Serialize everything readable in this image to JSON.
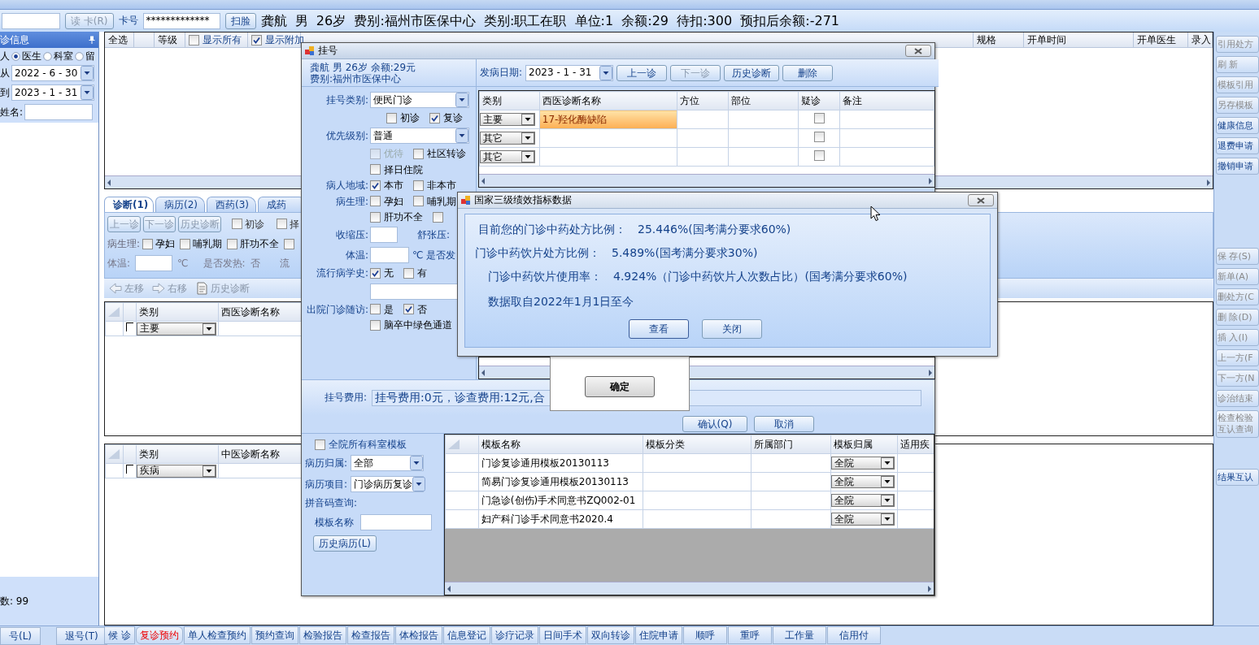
{
  "toolbar": {
    "read_card_button": "读 卡(R)",
    "card_label": "卡号",
    "card_number": "*************",
    "face_button": "扫脸",
    "patient_summary": "龚航  男  26岁  费别:福州市医保中心  类别:职工在职  单位:1  余额:29  待扣:300  预扣后余额:-271"
  },
  "left_panel": {
    "title": "诊信息",
    "radios": [
      {
        "label": "人",
        "selected": false
      },
      {
        "label": "医生",
        "selected": true
      },
      {
        "label": "科室",
        "selected": false
      },
      {
        "label": "留",
        "selected": false
      }
    ],
    "from_label": "从",
    "from_date": "2022 - 6 - 30",
    "to_label": "到",
    "to_date": "2023 - 1 - 31",
    "name_label": "姓名:",
    "count": "数: 99"
  },
  "main_grid": {
    "left_columns": [
      "全选",
      "等级"
    ],
    "toggles": [
      {
        "label": "显示所有",
        "checked": false
      },
      {
        "label": "显示附加",
        "checked": true
      }
    ],
    "right_columns": [
      "规格",
      "开单时间",
      "开单医生",
      "录入"
    ]
  },
  "tabs": [
    {
      "label": "诊断(1)",
      "selected": true
    },
    {
      "label": "病历(2)",
      "selected": false
    },
    {
      "label": "西药(3)",
      "selected": false
    },
    {
      "label": "成药",
      "selected": false
    }
  ],
  "diagnosis_panel": {
    "buttons": [
      "上一诊",
      "下一诊",
      "历史诊断"
    ],
    "visit_options": [
      {
        "label": "初诊",
        "checked": false
      },
      {
        "label": "择",
        "checked": false
      }
    ],
    "physiology_label": "病生理:",
    "physiology": [
      {
        "label": "孕妇",
        "checked": false
      },
      {
        "label": "哺乳期",
        "checked": false
      },
      {
        "label": "肝功不全",
        "checked": false
      },
      {
        "checked": false
      }
    ],
    "temperature_label": "体温:",
    "temperature_unit": "℃",
    "fever_label": "是否发热:",
    "fever_value": "否",
    "cut_label": "流"
  },
  "move_toolbar": [
    {
      "kind": "left",
      "label": "左移"
    },
    {
      "kind": "right",
      "label": "右移"
    },
    {
      "kind": "history",
      "label": "历史诊断"
    }
  ],
  "western_grid": {
    "columns": [
      "类别",
      "西医诊断名称"
    ],
    "rows": [
      {
        "type": "主要",
        "checked": false
      }
    ]
  },
  "tcm_grid": {
    "columns": [
      "类别",
      "中医诊断名称"
    ],
    "rows": [
      {
        "type": "疾病",
        "checked": false
      }
    ]
  },
  "side_buttons": [
    {
      "label": "引用处方",
      "disabled": true
    },
    {
      "label": "刷 新",
      "disabled": true
    },
    {
      "label": "模板引用",
      "disabled": true
    },
    {
      "label": "另存模板",
      "disabled": true
    },
    {
      "label": "健康信息",
      "disabled": false
    },
    {
      "label": "退费申请",
      "disabled": false
    },
    {
      "label": "撤销申请",
      "disabled": false
    },
    {
      "label": "保 存(S)",
      "disabled": true
    },
    {
      "label": "新单(A)",
      "disabled": true
    },
    {
      "label": "删处方(C",
      "disabled": true
    },
    {
      "label": "删 除(D)",
      "disabled": true
    },
    {
      "label": "插 入(I)",
      "disabled": true
    },
    {
      "label": "上一方(F",
      "disabled": true
    },
    {
      "label": "下一方(N",
      "disabled": true
    },
    {
      "label": "诊治结束",
      "disabled": true
    },
    {
      "label": "检查检验互认查询",
      "disabled": true
    },
    {
      "label": "结果互认",
      "disabled": false
    }
  ],
  "left_buttons": [
    "号(L)",
    "退号(T)"
  ],
  "bottom_tabs": [
    {
      "label": "候 诊",
      "alert": false
    },
    {
      "label": "复诊预约",
      "alert": true
    },
    {
      "label": "单人检查预约",
      "alert": false
    },
    {
      "label": "预约查询",
      "alert": false
    },
    {
      "label": "检验报告",
      "alert": false
    },
    {
      "label": "检查报告",
      "alert": false
    },
    {
      "label": "体检报告",
      "alert": false
    },
    {
      "label": "信息登记",
      "alert": false
    },
    {
      "label": "诊疗记录",
      "alert": false
    },
    {
      "label": "日间手术",
      "alert": false
    },
    {
      "label": "双向转诊",
      "alert": false
    },
    {
      "label": "住院申请",
      "alert": false
    },
    {
      "label": "顺呼",
      "alert": false
    },
    {
      "label": "重呼",
      "alert": false
    },
    {
      "label": "工作量",
      "alert": false
    },
    {
      "label": "信用付",
      "alert": false
    }
  ],
  "register_dialog": {
    "title": "挂号",
    "patient_line": "龚航 男 26岁 余额:29元",
    "fee_type_line": "费别:福州市医保中心",
    "register_type_label": "挂号类别:",
    "register_type": "便民门诊",
    "visit": [
      {
        "label": "初诊",
        "checked": false
      },
      {
        "label": "复诊",
        "checked": true
      }
    ],
    "priority_label": "优先级别:",
    "priority": "普通",
    "priority_options": [
      {
        "label": "优待",
        "checked": false,
        "disabled": true
      },
      {
        "label": "社区转诊",
        "checked": false,
        "disabled": false
      }
    ],
    "hospitalize": {
      "label": "择日住院",
      "checked": false
    },
    "region_label": "病人地域:",
    "region": [
      {
        "label": "本市",
        "checked": true
      },
      {
        "label": "非本市",
        "checked": false
      }
    ],
    "physiology_label": "病生理:",
    "physiology": [
      {
        "label": "孕妇",
        "checked": false
      },
      {
        "label": "哺乳期",
        "checked": false
      },
      {
        "label": "肝功不全",
        "checked": false
      },
      {
        "checked": false
      }
    ],
    "systolic_label": "收缩压:",
    "diastolic_label": "舒张压:",
    "temperature_label": "体温:",
    "temperature_unit": "℃",
    "fever_label": "是否发",
    "epidemic_label": "流行病学史:",
    "epidemic": [
      {
        "label": "无",
        "checked": true
      },
      {
        "label": "有",
        "checked": false
      }
    ],
    "followup_label": "出院门诊随访:",
    "followup": [
      {
        "label": "是",
        "checked": false
      },
      {
        "label": "否",
        "checked": true
      }
    ],
    "stroke": {
      "label": "脑卒中绿色通道",
      "checked": false
    },
    "onset_label": "发病日期:",
    "onset_date": "2023 - 1 - 31",
    "toolbar": [
      {
        "label": "上一诊",
        "disabled": false
      },
      {
        "label": "下一诊",
        "disabled": true
      },
      {
        "label": "历史诊断",
        "disabled": false
      },
      {
        "label": "删除",
        "disabled": false
      }
    ],
    "diagnosis_columns": [
      "类别",
      "西医诊断名称",
      "方位",
      "部位",
      "疑诊",
      "备注"
    ],
    "diagnosis_rows": [
      {
        "type": "主要",
        "name": "17-羟化酶缺陷",
        "selected": true,
        "suspected": false
      },
      {
        "type": "其它",
        "selected": false,
        "suspected": false
      },
      {
        "type": "其它",
        "selected": false,
        "suspected": false
      }
    ],
    "fee_label": "挂号费用:",
    "fee_value": "挂号费用:0元，诊查费用:12元,合",
    "confirm_button": "确认(Q)",
    "cancel_button": "取消",
    "all_templates": {
      "label": "全院所有科室模板",
      "checked": false
    },
    "owner_label": "病历归属:",
    "owner": "全部",
    "item_label": "病历项目:",
    "item": "门诊病历复诊",
    "pinyin_label": "拼音码查询:",
    "template_name_label": "模板名称",
    "history_button": "历史病历(L)",
    "template_columns": [
      "模板名称",
      "模板分类",
      "所属部门",
      "模板归属",
      "适用疾"
    ],
    "templates": [
      {
        "name": "门诊复诊通用模板20130113",
        "scope": "全院"
      },
      {
        "name": "简易门诊复诊通用模板20130113",
        "scope": "全院"
      },
      {
        "name": "门急诊(创伤)手术同意书ZQ002-01",
        "scope": "全院"
      },
      {
        "name": "妇产科门诊手术同意书2020.4",
        "scope": "全院"
      }
    ]
  },
  "message_box": {
    "button": "确定"
  },
  "indicator_dialog": {
    "title": "国家三级绩效指标数据",
    "lines": [
      {
        "label": "目前您的门诊中药处方比例：",
        "value": "25.446%(国考满分要求60%)"
      },
      {
        "label": "门诊中药饮片处方比例：",
        "value": "5.489%(国考满分要求30%)"
      },
      {
        "label": "门诊中药饮片使用率：",
        "value": "4.924%（门诊中药饮片人次数占比）(国考满分要求60%)"
      }
    ],
    "note": "数据取自2022年1月1日至今",
    "buttons": [
      "查看",
      "关闭"
    ]
  }
}
